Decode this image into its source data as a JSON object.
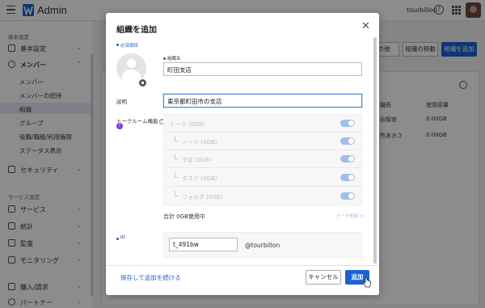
{
  "app": {
    "title": "Admin",
    "brand_color": "#1a62d6"
  },
  "header": {
    "user_name": "tourbillon",
    "help_icon": "question-circle-icon",
    "apps_icon": "app-grid-icon"
  },
  "sidebar": {
    "section_basic": "基本設定",
    "items_basic": [
      {
        "label": "基本設定",
        "icon": "building-icon"
      },
      {
        "label": "メンバー",
        "icon": "people-icon"
      }
    ],
    "member_sub": [
      "メンバー",
      "メンバーの招待",
      "組織",
      "グループ",
      "役職/職級/利用権限",
      "ステータス表示"
    ],
    "active_sub": "組織",
    "security": "セキュリティ",
    "section_service": "サービス設定",
    "items_service": [
      "サービス",
      "統計",
      "監査",
      "モニタリング"
    ],
    "items_bottom": [
      "購入/請求",
      "パートナー"
    ]
  },
  "main_bg": {
    "btn_more": "の他",
    "btn_move": "組織の移動",
    "btn_add_org": "組織を追加",
    "col_head_1": "織長",
    "col_head_2": "使用容量",
    "row1_name": "谷智宣",
    "row1_usage": "0.00GB",
    "row2_name": "所あきさ",
    "row2_usage": "0.00GB"
  },
  "modal": {
    "title": "組織を追加",
    "required_note": "必須項目",
    "org_name_label": "組織名",
    "org_name_value": "町田支店",
    "desc_label": "説明",
    "desc_value": "東京都町田市の支店",
    "talk_label": "トークルーム機能",
    "features": [
      {
        "label": "トーク (0GB)",
        "indent": 0,
        "on": true
      },
      {
        "label": "ノート (0GB)",
        "indent": 1,
        "on": true
      },
      {
        "label": "予定 (0GB)",
        "indent": 1,
        "on": true
      },
      {
        "label": "タスク (0GB)",
        "indent": 1,
        "on": true
      },
      {
        "label": "フォルダ (0GB)",
        "indent": 1,
        "on": true
      }
    ],
    "total": "合計 0GB使用中",
    "detail_link": "データ削除 >",
    "id_label": "ID",
    "id_value": "t_491bw",
    "id_suffix": "@tourbillon",
    "save_continue": "保存して追加を続ける",
    "cancel": "キャンセル",
    "add": "追加"
  }
}
